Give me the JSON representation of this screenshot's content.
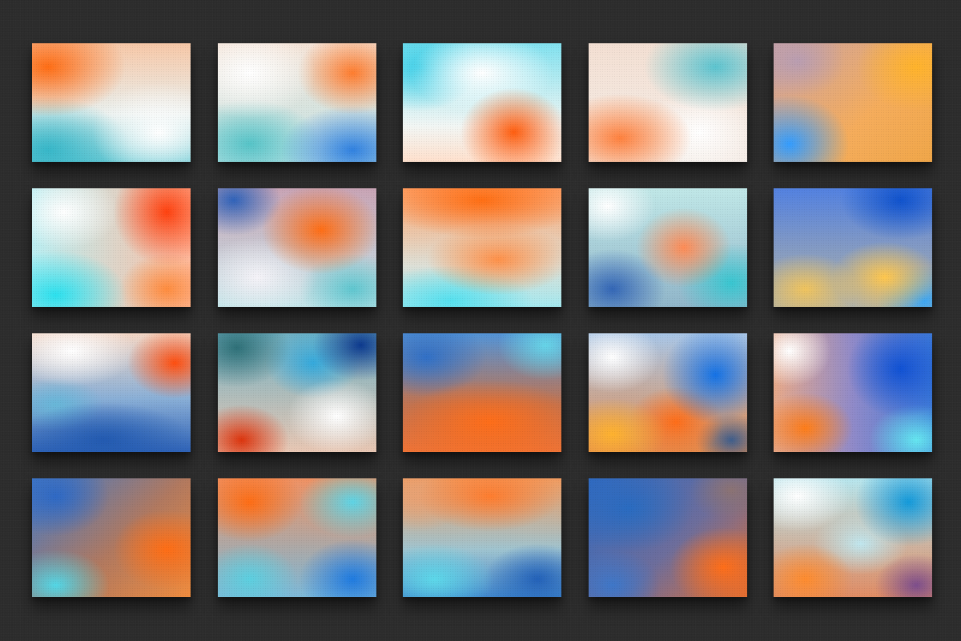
{
  "swatches": [
    {
      "row": 1,
      "col": 1,
      "colors": [
        "#ff6a10",
        "#ffffff",
        "#33b6c8"
      ]
    },
    {
      "row": 1,
      "col": 2,
      "colors": [
        "#ffffff",
        "#ff7a2a",
        "#2c7fe0",
        "#52c3c7"
      ]
    },
    {
      "row": 1,
      "col": 3,
      "colors": [
        "#3fd0e8",
        "#ffffff",
        "#ff5a0a"
      ]
    },
    {
      "row": 1,
      "col": 4,
      "colors": [
        "#ff7f3a",
        "#ffffff",
        "#58c3cf"
      ]
    },
    {
      "row": 1,
      "col": 5,
      "colors": [
        "#b89cb0",
        "#ffb227",
        "#2f9bff"
      ]
    },
    {
      "row": 2,
      "col": 1,
      "colors": [
        "#ffffff",
        "#ff3d0a",
        "#27e0ee"
      ]
    },
    {
      "row": 2,
      "col": 2,
      "colors": [
        "#2b5fb8",
        "#ff6a10",
        "#f5f3f8",
        "#5bc6cf"
      ]
    },
    {
      "row": 2,
      "col": 3,
      "colors": [
        "#ff6b0f",
        "#ff8f45",
        "#52e0ef"
      ]
    },
    {
      "row": 2,
      "col": 4,
      "colors": [
        "#ffffff",
        "#ff8a52",
        "#2f63b5",
        "#34c5d0"
      ]
    },
    {
      "row": 2,
      "col": 5,
      "colors": [
        "#0b4fcc",
        "#ffc64a",
        "#3aa5f2"
      ]
    },
    {
      "row": 3,
      "col": 1,
      "colors": [
        "#ffffff",
        "#ff4a0a",
        "#1e57b0"
      ]
    },
    {
      "row": 3,
      "col": 2,
      "colors": [
        "#2a6d75",
        "#07358c",
        "#ffffff",
        "#dc3008"
      ]
    },
    {
      "row": 3,
      "col": 3,
      "colors": [
        "#2c6dc6",
        "#63d4e8",
        "#ff6a14"
      ]
    },
    {
      "row": 3,
      "col": 4,
      "colors": [
        "#ffffff",
        "#0f6fe6",
        "#ffb12a",
        "#ff6a14"
      ]
    },
    {
      "row": 3,
      "col": 5,
      "colors": [
        "#ffffff",
        "#0b4ed4",
        "#ff7a14",
        "#62e6f0"
      ]
    },
    {
      "row": 4,
      "col": 1,
      "colors": [
        "#2a66c4",
        "#ff6a10",
        "#4fd6e6"
      ]
    },
    {
      "row": 4,
      "col": 2,
      "colors": [
        "#ff6a10",
        "#5ad4e6",
        "#1a78e0"
      ]
    },
    {
      "row": 4,
      "col": 3,
      "colors": [
        "#ff7a2a",
        "#59d8ea",
        "#1e5eb8"
      ]
    },
    {
      "row": 4,
      "col": 4,
      "colors": [
        "#2568c0",
        "#ff6a14",
        "#8a7070"
      ]
    },
    {
      "row": 4,
      "col": 5,
      "colors": [
        "#ffffff",
        "#0e98da",
        "#ff8a2a",
        "#7a4a8a"
      ]
    }
  ],
  "background_color": "#2c2c2c"
}
